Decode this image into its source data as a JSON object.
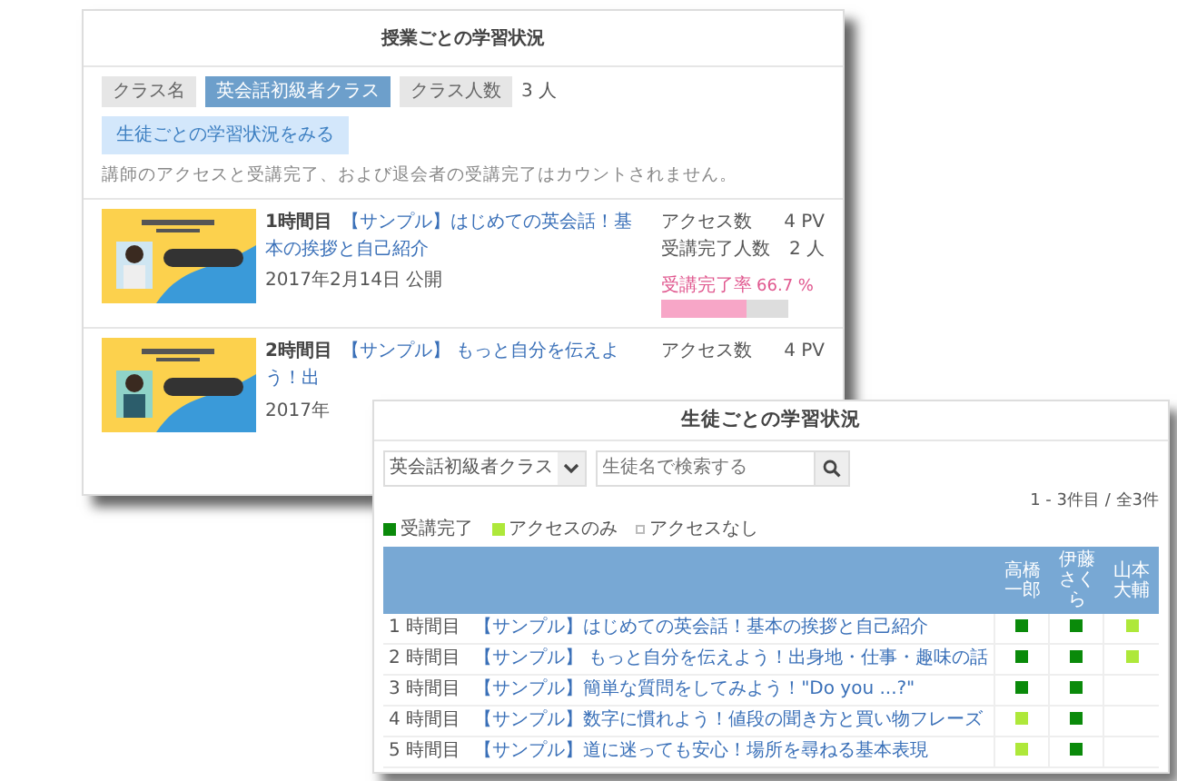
{
  "lessons_window": {
    "title": "授業ごとの学習状況",
    "class_label": "クラス名",
    "class_name": "英会話初級者クラス",
    "count_label": "クラス人数",
    "count": "3 人",
    "student_button": "生徒ごとの学習状況をみる",
    "note": "講師のアクセスと受講完了、および退会者の受講完了はカウントされません。",
    "lessons": [
      {
        "number": "1時間目",
        "title_lines": [
          "【サンプル】はじめての英会話！基",
          "本の挨拶と自己紹介"
        ],
        "date": "2017年2月14日 公開",
        "stats": [
          {
            "label": "アクセス数",
            "value": "4 PV"
          },
          {
            "label": "受講完了人数",
            "value": "2 人"
          }
        ],
        "rate_label": "受講完了率",
        "rate": "66.7 %",
        "level": 0.667
      },
      {
        "number": "2時間目",
        "title_lines": [
          "【サンプル】 もっと自分を伝えよ",
          "う！出"
        ],
        "date": "2017年",
        "stats": [
          {
            "label": "アクセス数",
            "value": "4 PV"
          }
        ]
      }
    ]
  },
  "students_window": {
    "title": "生徒ごとの学習状況",
    "class_select": "英会話初級者クラス",
    "search": {
      "placeholder": "生徒名で検索する"
    },
    "pager": "1 - 3件目 / 全3件",
    "legend": [
      {
        "kind": "filled",
        "color": "#0a8a0a",
        "label": "受講完了"
      },
      {
        "kind": "filled",
        "color": "#aee83a",
        "label": "アクセスのみ"
      },
      {
        "kind": "outline",
        "label": "アクセスなし"
      }
    ],
    "students": [
      {
        "name_lines": [
          "高橋",
          "一郎"
        ]
      },
      {
        "name_lines": [
          "伊藤",
          "さくら"
        ]
      },
      {
        "name_lines": [
          "山本",
          "大輔"
        ]
      }
    ],
    "rows": [
      {
        "lesson": "1 時間目",
        "title": "【サンプル】はじめての英会話！基本の挨拶と自己紹介",
        "marks": [
          {
            "kind": "filled",
            "color": "#0a8a0a"
          },
          {
            "kind": "filled",
            "color": "#0a8a0a"
          },
          {
            "kind": "filled",
            "color": "#aee83a"
          }
        ]
      },
      {
        "lesson": "2 時間目",
        "title": "【サンプル】 もっと自分を伝えよう！出身地・仕事・趣味の話",
        "marks": [
          {
            "kind": "filled",
            "color": "#0a8a0a"
          },
          {
            "kind": "filled",
            "color": "#0a8a0a"
          },
          {
            "kind": "filled",
            "color": "#aee83a"
          }
        ]
      },
      {
        "lesson": "3 時間目",
        "title": "【サンプル】簡単な質問をしてみよう！\"Do you ...?\"",
        "marks": [
          {
            "kind": "filled",
            "color": "#0a8a0a"
          },
          {
            "kind": "filled",
            "color": "#0a8a0a"
          },
          {
            "kind": "empty"
          }
        ]
      },
      {
        "lesson": "4 時間目",
        "title": "【サンプル】数字に慣れよう！値段の聞き方と買い物フレーズ",
        "marks": [
          {
            "kind": "filled",
            "color": "#aee83a"
          },
          {
            "kind": "filled",
            "color": "#0a8a0a"
          },
          {
            "kind": "empty"
          }
        ]
      },
      {
        "lesson": "5 時間目",
        "title": "【サンプル】道に迷っても安心！場所を尋ねる基本表現",
        "marks": [
          {
            "kind": "filled",
            "color": "#aee83a"
          },
          {
            "kind": "filled",
            "color": "#0a8a0a"
          },
          {
            "kind": "empty"
          }
        ]
      }
    ]
  }
}
